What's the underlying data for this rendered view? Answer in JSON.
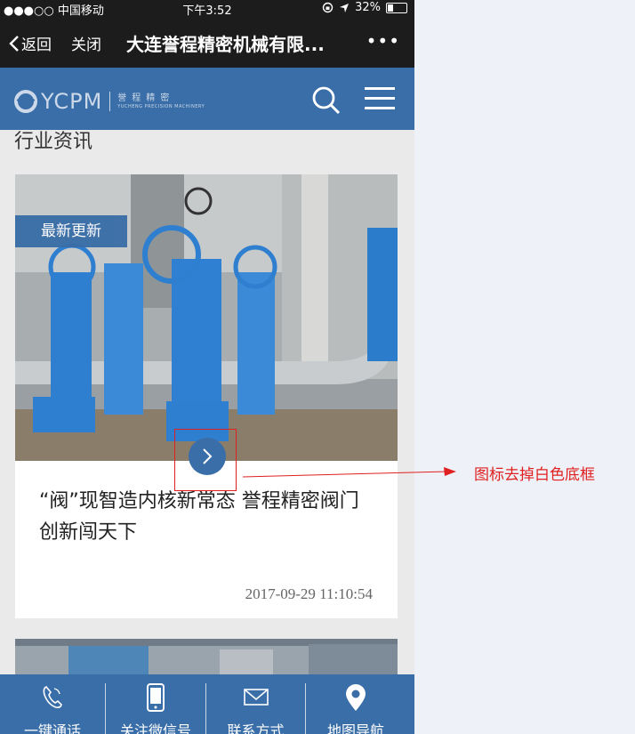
{
  "status_bar": {
    "carrier": "●●●○○ 中国移动",
    "time": "下午3:52",
    "battery": "32%",
    "battery_level": 0.32
  },
  "nav_bar": {
    "back_label": "返回",
    "close_label": "关闭",
    "title": "大连誉程精密机械有限...",
    "more_label": "•••"
  },
  "header": {
    "logo_text": "YCPM",
    "logo_cn": "誉程精密",
    "logo_en": "YUCHENG PRECISION MACHINERY"
  },
  "section_title": "行业资讯",
  "article": {
    "badge": "最新更新",
    "title": "“阀”现智造内核新常态 誉程精密阀门创新闯天下",
    "date": "2017-09-29 11:10:54"
  },
  "tab_bar": {
    "items": [
      {
        "label": "一键通话",
        "icon": "phone-icon"
      },
      {
        "label": "关注微信号",
        "icon": "mobile-icon"
      },
      {
        "label": "联系方式",
        "icon": "envelope-icon"
      },
      {
        "label": "地图导航",
        "icon": "map-pin-icon"
      }
    ]
  },
  "annotation": {
    "text": "图标去掉白色底框"
  },
  "colors": {
    "brand_blue": "#3a6ea8",
    "dark_bar": "#1c1c1c",
    "annotation_red": "#e02020"
  }
}
